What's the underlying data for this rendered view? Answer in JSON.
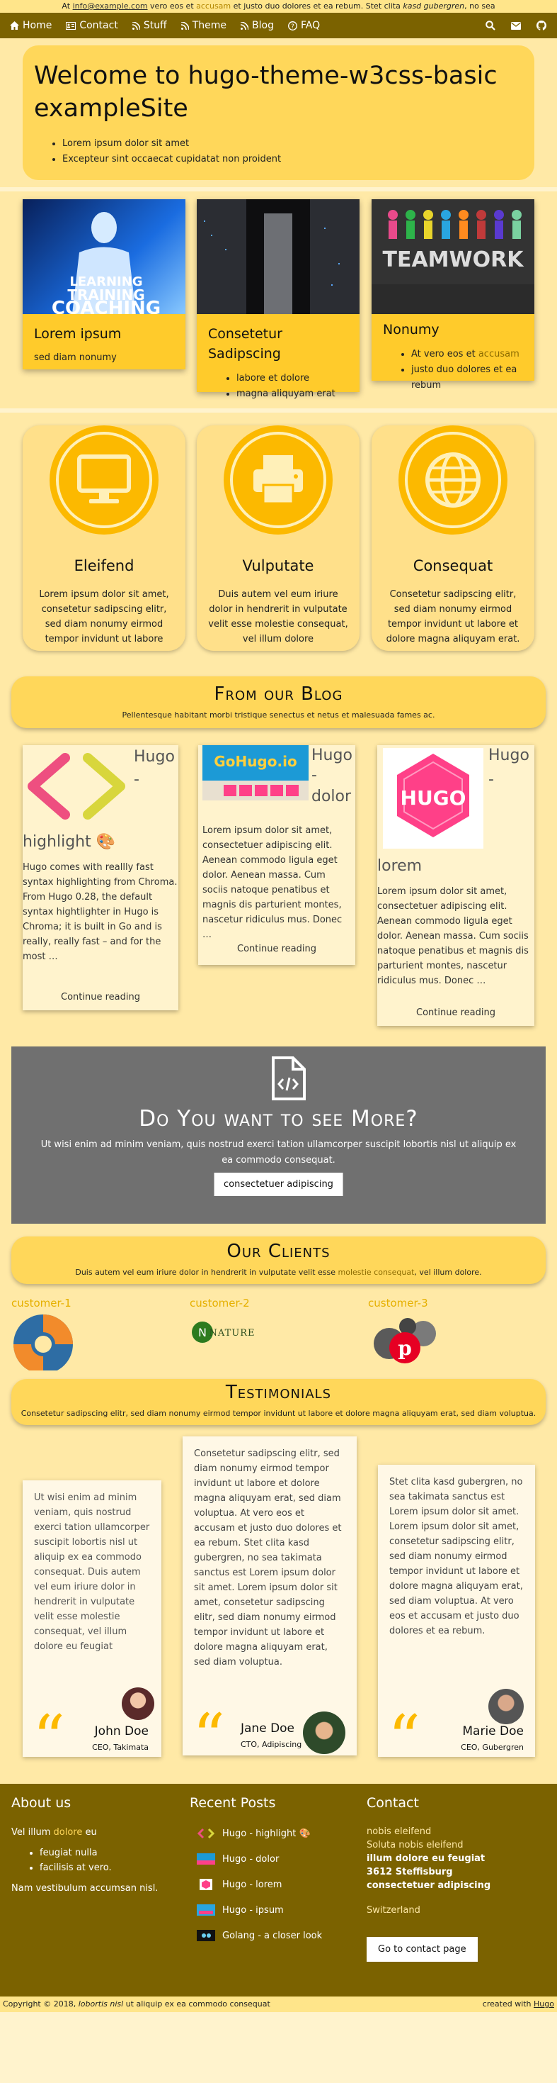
{
  "topbar": {
    "prefix": "At ",
    "email": "info@example.com",
    "mid": " vero eos et ",
    "accent": "accusam",
    "rest": " et justo duo dolores et ea rebum. Stet clita ",
    "italic": "kasd gubergren",
    "tail": ", no sea"
  },
  "nav": {
    "items": [
      {
        "label": "Home",
        "icon": "home-icon"
      },
      {
        "label": "Contact",
        "icon": "address-card-icon"
      },
      {
        "label": "Stuff",
        "icon": "rss-icon"
      },
      {
        "label": "Theme",
        "icon": "rss-icon"
      },
      {
        "label": "Blog",
        "icon": "rss-icon"
      },
      {
        "label": "FAQ",
        "icon": "question-icon"
      }
    ],
    "right_icons": [
      "search-icon",
      "envelope-icon",
      "github-icon"
    ]
  },
  "hero": {
    "title": "Welcome to hugo-theme-w3css-basic exampleSite",
    "bullets": [
      "Lorem ipsum dolor sit amet",
      "Excepteur sint occaecat cupidatat non proident"
    ]
  },
  "features": [
    {
      "title": "Lorem ipsum",
      "text": "sed diam nonumy",
      "image_text": [
        "LEARNING",
        "TRAINING",
        "COACHING"
      ]
    },
    {
      "title": "Consetetur Sadipscing",
      "bullets": [
        "labore et dolore",
        "magna aliquyam erat"
      ]
    },
    {
      "title": "Nonumy",
      "bullets_prefix": "At vero eos et ",
      "bullets_accent": "accusam",
      "bullet2": "justo duo dolores et ea rebum",
      "image_text": "TEAMWORK"
    }
  ],
  "services": [
    {
      "title": "Eleifend",
      "icon": "desktop-icon",
      "text": "Lorem ipsum dolor sit amet, consetetur sadipscing elitr, sed diam nonumy eirmod tempor invidunt ut labore"
    },
    {
      "title": "Vulputate",
      "icon": "print-icon",
      "text": "Duis autem vel eum iriure dolor in hendrerit in vulputate velit esse molestie consequat, vel illum dolore"
    },
    {
      "title": "Consequat",
      "icon": "globe-icon",
      "text": "Consetetur sadipscing elitr, sed diam nonumy eirmod tempor invidunt ut labore et dolore magna aliquyam erat."
    }
  ],
  "blog": {
    "title": "From our Blog",
    "subtitle": "Pellentesque habitant morbi tristique senectus et netus et malesuada fames ac.",
    "posts": [
      {
        "title_a": "Hugo",
        "title_b": "-",
        "title_c": "highlight 🎨",
        "text": "Hugo comes with reallly fast syntax highlighting from Chroma. From Hugo 0.28, the default syntax hightlighter in Hugo is Chroma; it is built in Go and is really, really fast – and for the most …",
        "more": "Continue reading"
      },
      {
        "title_a": "Hugo",
        "title_b": "-",
        "title_c": "dolor",
        "image_text": "GoHugo.io",
        "text": "Lorem ipsum dolor sit amet, consectetuer adipiscing elit. Aenean commodo ligula eget dolor. Aenean massa. Cum sociis natoque penatibus et magnis dis parturient montes, nascetur ridiculus mus. Donec …",
        "more": "Continue reading"
      },
      {
        "title_a": "Hugo",
        "title_b": "-",
        "title_c": "lorem",
        "image_text": "HUGO",
        "text": "Lorem ipsum dolor sit amet, consectetuer adipiscing elit. Aenean commodo ligula eget dolor. Aenean massa. Cum sociis natoque penatibus et magnis dis parturient montes, nascetur ridiculus mus. Donec …",
        "more": "Continue reading"
      }
    ]
  },
  "cta": {
    "title": "Do You want to see More?",
    "text": "Ut wisi enim ad minim veniam, quis nostrud exerci tation ullamcorper suscipit lobortis nisl ut aliquip ex ea commodo consequat.",
    "button": "consectetuer adipiscing"
  },
  "clients": {
    "title": "Our Clients",
    "subtitle_a": "Duis autem vel eum iriure dolor in hendrerit in vulputate velit esse ",
    "subtitle_accent": "molestie consequat",
    "subtitle_b": ", vel illum dolore.",
    "items": [
      {
        "name": "customer-1"
      },
      {
        "name": "customer-2",
        "logo_text": "NATURE"
      },
      {
        "name": "customer-3"
      }
    ]
  },
  "testimonials": {
    "title": "Testimonials",
    "subtitle": "Consetetur sadipscing elitr, sed diam nonumy eirmod tempor invidunt ut labore et dolore magna aliquyam erat, sed diam voluptua.",
    "items": [
      {
        "text": "Ut wisi enim ad minim veniam, quis nostrud exerci tation ullamcorper suscipit lobortis nisl ut aliquip ex ea commodo consequat. Duis autem vel eum iriure dolor in hendrerit in vulputate velit esse molestie consequat, vel illum dolore eu feugiat",
        "name": "John Doe",
        "role": "CEO, Takimata"
      },
      {
        "text": "Consetetur sadipscing elitr, sed diam nonumy eirmod tempor invidunt ut labore et dolore magna aliquyam erat, sed diam voluptua. At vero eos et accusam et justo duo dolores et ea rebum. Stet clita kasd gubergren, no sea takimata sanctus est Lorem ipsum dolor sit amet. Lorem ipsum dolor sit amet, consetetur sadipscing elitr, sed diam nonumy eirmod tempor invidunt ut labore et dolore magna aliquyam erat, sed diam voluptua.",
        "name": "Jane Doe",
        "role": "CTO, Adipiscing"
      },
      {
        "text": "Stet clita kasd gubergren, no sea takimata sanctus est Lorem ipsum dolor sit amet. Lorem ipsum dolor sit amet, consetetur sadipscing elitr, sed diam nonumy eirmod tempor invidunt ut labore et dolore magna aliquyam erat, sed diam voluptua. At vero eos et accusam et justo duo dolores et ea rebum.",
        "name": "Marie Doe",
        "role": "CEO, Gubergren"
      }
    ]
  },
  "footer": {
    "about_title": "About us",
    "about_a": "Vel illum ",
    "about_accent": "dolore",
    "about_b": " eu",
    "about_bullets": [
      "feugiat nulla",
      "facilisis at vero."
    ],
    "about_end": "Nam vestibulum accumsan nisl.",
    "recent_title": "Recent Posts",
    "recent": [
      "Hugo - highlight 🎨",
      "Hugo - dolor",
      "Hugo - lorem",
      "Hugo - ipsum",
      "Golang - a closer look"
    ],
    "contact_title": "Contact",
    "contact_lines": [
      "nobis eleifend",
      "Soluta nobis eleifend"
    ],
    "contact_bold": [
      "illum dolore eu feugiat",
      "3612 Steffisburg",
      "consectetuer adipiscing"
    ],
    "contact_country": "Switzerland",
    "contact_button": "Go to contact page"
  },
  "copyright": {
    "left_a": "Copyright © 2018, ",
    "left_italic": "lobortis nisl",
    "left_b": " ut aliquip ex ea commodo consequat",
    "right_a": "created with ",
    "right_link": "Hugo"
  },
  "colors": {
    "accent": "#fcb900",
    "brand": "#7b6200",
    "panel": "#ffd75a"
  }
}
